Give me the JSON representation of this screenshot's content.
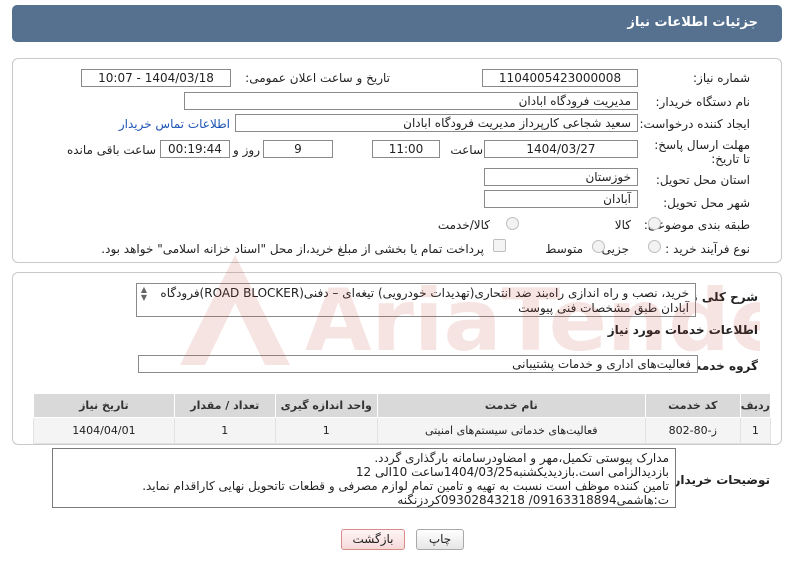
{
  "header": {
    "title": "جزئیات اطلاعات نیاز"
  },
  "form": {
    "need_number_label": "شماره نیاز:",
    "need_number": "1104005423000008",
    "announce_label": "تاریخ و ساعت اعلان عمومی:",
    "announce_value": "1404/03/18 - 10:07",
    "buyer_org_label": "نام دستگاه خریدار:",
    "buyer_org": "مدیریت فرودگاه ابادان",
    "requester_label": "ایجاد کننده درخواست:",
    "requester": "سعید شجاعی کارپرداز مدیریت فرودگاه ابادان",
    "contact_link": "اطلاعات تماس خریدار",
    "deadline_label": "مهلت ارسال پاسخ: تا تاریخ:",
    "deadline_date": "1404/03/27",
    "time_label": "ساعت",
    "deadline_time": "11:00",
    "days_value": "9",
    "days_label": "روز و",
    "remaining_time": "00:19:44",
    "remaining_label": "ساعت باقی مانده",
    "province_label": "استان محل تحویل:",
    "province": "خوزستان",
    "city_label": "شهر محل تحویل:",
    "city": "آبادان",
    "category_label": "طبقه بندی موضوعی:",
    "category_options": [
      "کالا",
      "کالا/خدمت"
    ],
    "process_label": "نوع فرآیند خرید :",
    "process_options": [
      "جزیی",
      "متوسط"
    ],
    "payment_note": "پرداخت تمام یا بخشی از مبلغ خرید،از محل \"اسناد خزانه اسلامی\" خواهد بود."
  },
  "description": {
    "label": "شرح کلی نیاز:",
    "line1": "خرید، نصب و راه اندازی راه‌بند ضد انتحاری(تهدیدات خودرویی) تیغه‌ای – دفنی(ROAD BLOCKER)فرودگاه",
    "line2": "آبادان طبق مشخصات فنی پیوست"
  },
  "services": {
    "section_title": "اطلاعات خدمات مورد نیاز",
    "group_label": "گروه خدمت:",
    "group_value": "فعالیت‌های اداری و خدمات پشتیبانی",
    "columns": [
      "ردیف",
      "کد خدمت",
      "نام خدمت",
      "واحد اندازه گیری",
      "تعداد / مقدار",
      "تاریخ نیاز"
    ],
    "rows": [
      [
        "1",
        "ز-80-802",
        "فعالیت‌های خدماتی سیستم‌های امنیتی",
        "1",
        "1",
        "1404/04/01"
      ]
    ]
  },
  "buyer_notes": {
    "label": "توضیحات خریدار:",
    "line1": "مدارک پیوستی تکمیل،مهر و امضاودرسامانه بارگذاری گردد.",
    "line2": "بازدیدالزامی است.بازدیدیکشنبه1404/03/25ساعت 10الی 12",
    "line3": "تامین کننده موظف است نسبت به تهیه و تامین تمام لوازم مصرفی و قطعات تاتحویل نهایی کاراقدام نماید.",
    "line4": "ت:هاشمی09163318894/ 09302843218کردزنگنه"
  },
  "buttons": {
    "print": "چاپ",
    "back": "بازگشت"
  },
  "watermark_text": "AriaTender.neT",
  "colors": {
    "header_bg": "#55718f",
    "link": "#1f55b5",
    "watermark": "#c0392b"
  }
}
